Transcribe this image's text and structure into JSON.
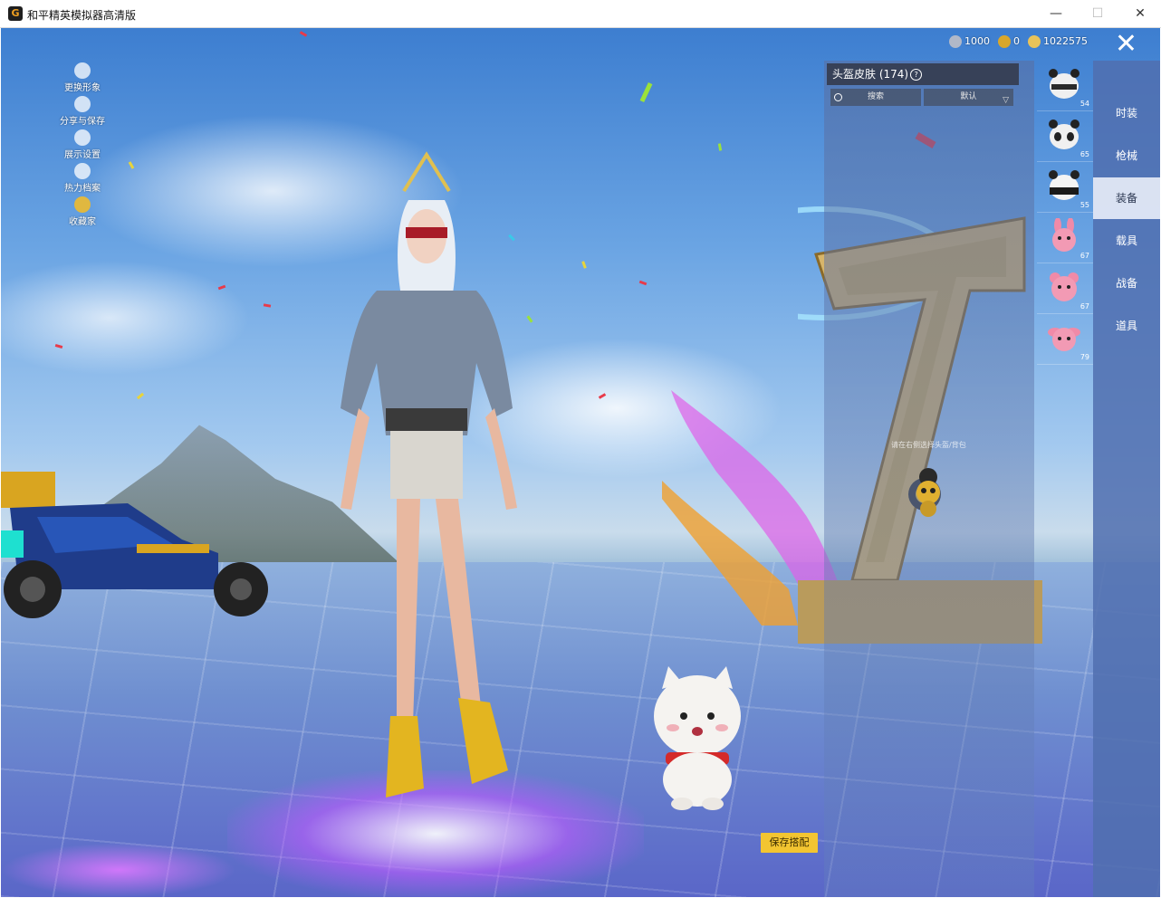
{
  "window": {
    "title": "和平精英模拟器高清版",
    "icon_glyph": "G",
    "controls": {
      "minimize": "—",
      "maximize": "☐",
      "close": "✕"
    }
  },
  "side_menu": [
    {
      "label": "更换形象",
      "icon": "avatar-icon"
    },
    {
      "label": "分享与保存",
      "icon": "share-icon"
    },
    {
      "label": "展示设置",
      "icon": "eye-icon"
    },
    {
      "label": "热力档案",
      "icon": "flame-icon"
    },
    {
      "label": "收藏家",
      "icon": "collector-badge-icon"
    }
  ],
  "currency": [
    {
      "icon": "silver-coin-icon",
      "value": "1000",
      "color": "#b0b8c8"
    },
    {
      "icon": "a-coupon-icon",
      "value": "0",
      "color": "#d9a72b"
    },
    {
      "icon": "gold-coin-icon",
      "value": "1022575",
      "color": "#e8c35a"
    }
  ],
  "panel": {
    "title": "头盔皮肤 (174)",
    "help_glyph": "?",
    "search_placeholder": "搜索",
    "sort_value": "默认",
    "hint": "请在右侧选择头盔/背包"
  },
  "items": [
    {
      "name": "panda-helmet-1",
      "count": "54"
    },
    {
      "name": "panda-helmet-2",
      "count": "65"
    },
    {
      "name": "panda-helmet-3",
      "count": "55"
    },
    {
      "name": "pink-bunny-1",
      "count": "67"
    },
    {
      "name": "pink-bear",
      "count": "67"
    },
    {
      "name": "pink-bunny-2",
      "count": "79"
    }
  ],
  "tabs": [
    {
      "label": "时装",
      "active": false
    },
    {
      "label": "枪械",
      "active": false
    },
    {
      "label": "装备",
      "active": true
    },
    {
      "label": "载具",
      "active": false
    },
    {
      "label": "战备",
      "active": false
    },
    {
      "label": "道具",
      "active": false
    }
  ],
  "save_button": "保存搭配",
  "colors": {
    "accent_yellow": "#f3c531",
    "tab_bar": "#506eaf",
    "active_tab": "#e1e8f5"
  }
}
